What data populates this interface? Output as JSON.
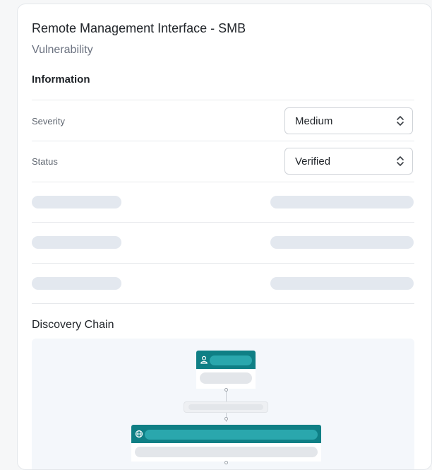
{
  "card": {
    "title": "Remote Management Interface - SMB",
    "subtitle": "Vulnerability"
  },
  "information": {
    "heading": "Information",
    "rows": [
      {
        "label": "Severity",
        "value": "Medium"
      },
      {
        "label": "Status",
        "value": "Verified"
      }
    ],
    "loading_rows": 3
  },
  "discovery_chain": {
    "heading": "Discovery Chain",
    "nodes": [
      {
        "icon": "user-icon",
        "color": "#0f7f85"
      },
      {
        "icon": "globe-icon",
        "color": "#0f7f85"
      }
    ]
  },
  "colors": {
    "accent": "#0f7f85",
    "accent_light": "#2aa7ad",
    "skeleton": "#e3e8ef"
  }
}
